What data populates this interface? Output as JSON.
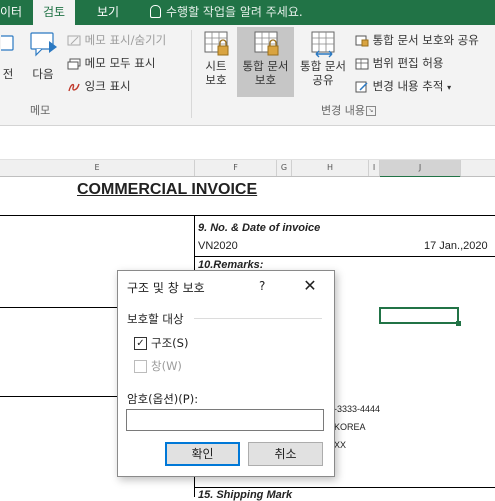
{
  "tabs": {
    "partial": "이터",
    "review": "검토",
    "view": "보기",
    "tell_me": "수행할 작업을 알려 주세요."
  },
  "ribbon": {
    "memo_group": {
      "label": "메모",
      "prev_partial": "전",
      "next": "다음",
      "show_hide": "메모 표시/숨기기",
      "show_all": "메모 모두 표시",
      "show_ink": "잉크 표시"
    },
    "changes_group": {
      "label": "변경 내용",
      "protect_sheet": [
        "시트",
        "보호"
      ],
      "protect_workbook": [
        "통합 문서",
        "보호"
      ],
      "share_workbook": [
        "통합 문서",
        "공유"
      ],
      "protect_share": "통합 문서 보호와 공유",
      "allow_edit_ranges": "범위 편집 허용",
      "track_changes": "변경 내용 추적"
    }
  },
  "columns": [
    "E",
    "F",
    "G",
    "H",
    "I",
    "J"
  ],
  "sheet": {
    "title": "COMMERCIAL INVOICE",
    "invoice_label": "9. No. & Date of invoice",
    "invoice_no": "VN2020",
    "invoice_date": "17 Jan.,2020",
    "remarks_label": "10.Remarks:",
    "phone_partial": "-3333-4444",
    "country_partial": "KOREA",
    "xx_partial": "XX",
    "shipping_partial": "15. Shipping Mark"
  },
  "dialog": {
    "title": "구조 및 창 보호",
    "help": "?",
    "close": "✕",
    "section": "보호할 대상",
    "structure_label": "구조(S)",
    "structure_checked": true,
    "windows_label": "창(W)",
    "windows_checked": false,
    "password_label": "암호(옵션)(P):",
    "password_value": "",
    "ok": "확인",
    "cancel": "취소"
  }
}
